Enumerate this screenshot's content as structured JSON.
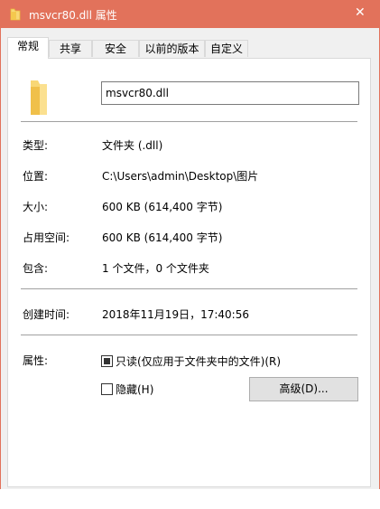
{
  "window": {
    "title": "msvcr80.dll 属性",
    "close_glyph": "✕",
    "accent_color": "#e2725b"
  },
  "tabs": [
    {
      "label": "常规",
      "active": true
    },
    {
      "label": "共享",
      "active": false
    },
    {
      "label": "安全",
      "active": false
    },
    {
      "label": "以前的版本",
      "active": false
    },
    {
      "label": "自定义",
      "active": false
    }
  ],
  "general": {
    "name_value": "msvcr80.dll",
    "rows": {
      "type": {
        "label": "类型:",
        "value": "文件夹 (.dll)"
      },
      "location": {
        "label": "位置:",
        "value": "C:\\Users\\admin\\Desktop\\图片"
      },
      "size": {
        "label": "大小:",
        "value": "600 KB (614,400 字节)"
      },
      "size_on_disk": {
        "label": "占用空间:",
        "value": "600 KB (614,400 字节)"
      },
      "contains": {
        "label": "包含:",
        "value": "1 个文件，0 个文件夹"
      },
      "created": {
        "label": "创建时间:",
        "value": "2018年11月19日，17:40:56"
      }
    },
    "attributes": {
      "label": "属性:",
      "readonly": {
        "label": "只读(仅应用于文件夹中的文件)(R)",
        "state": "indeterminate"
      },
      "hidden": {
        "label": "隐藏(H)",
        "checked": false
      },
      "advanced_button": "高级(D)..."
    }
  },
  "icons": {
    "title_icon": "folder-icon",
    "main_icon": "folder-icon"
  }
}
